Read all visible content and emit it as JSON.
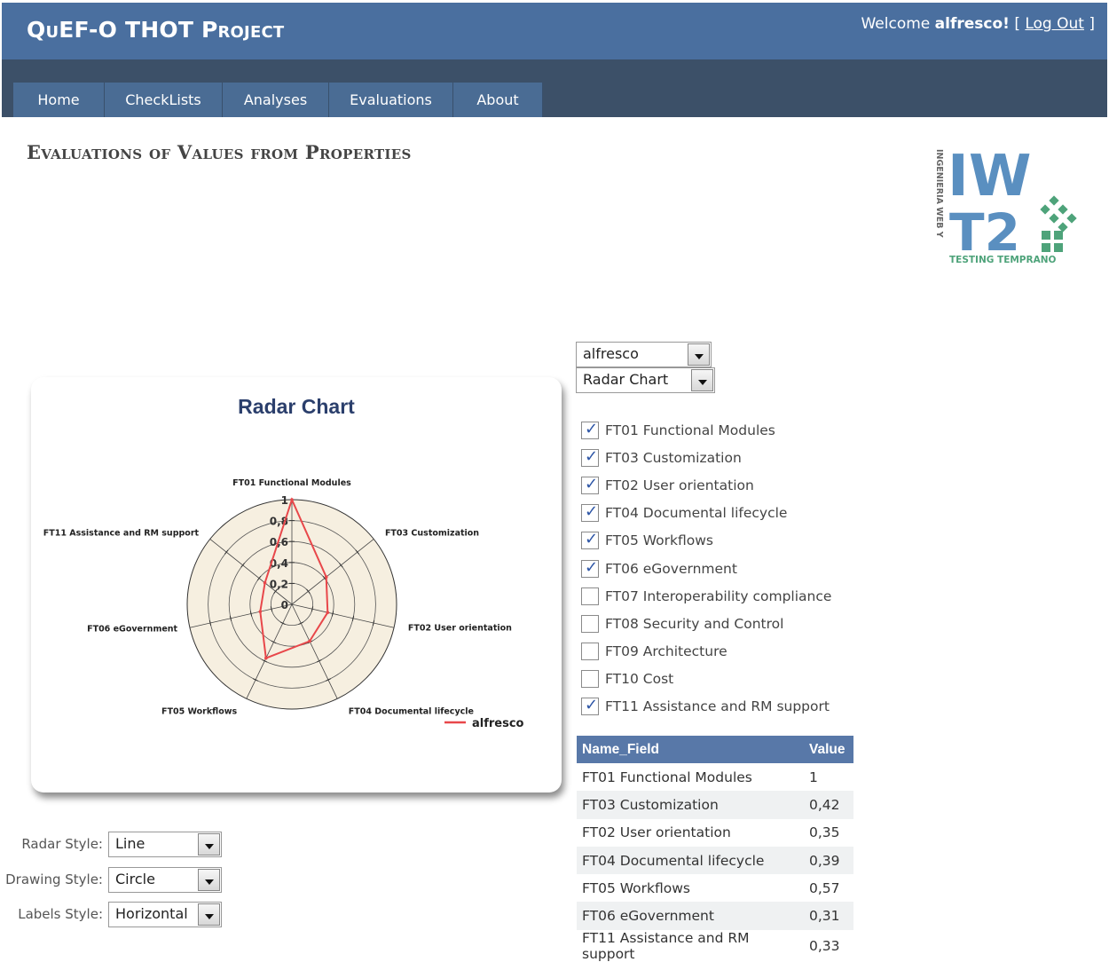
{
  "header": {
    "app_title": "QuEF-O THOT Project",
    "welcome_prefix": "Welcome",
    "username": "alfresco!",
    "bracket_open": "[",
    "logout_label": "Log Out",
    "bracket_close": "]"
  },
  "menu": {
    "items": [
      {
        "label": "Home"
      },
      {
        "label": "CheckLists"
      },
      {
        "label": "Analyses"
      },
      {
        "label": "Evaluations"
      },
      {
        "label": "About"
      }
    ]
  },
  "page": {
    "title": "Evaluations of Values from Properties"
  },
  "logo": {
    "letters_top": "IW",
    "letters_bottom": "T2",
    "side_text": "INGENIERIA WEB Y",
    "bottom_text": "TESTING TEMPRANO",
    "colors": {
      "blue": "#5a8fc0",
      "green": "#4ea37a"
    }
  },
  "selects": {
    "product": "alfresco",
    "chart_type": "Radar Chart"
  },
  "checklist": [
    {
      "label": "FT01 Functional Modules",
      "checked": true
    },
    {
      "label": "FT03 Customization",
      "checked": true
    },
    {
      "label": "FT02 User orientation",
      "checked": true
    },
    {
      "label": "FT04 Documental lifecycle",
      "checked": true
    },
    {
      "label": "FT05 Workflows",
      "checked": true
    },
    {
      "label": "FT06 eGovernment",
      "checked": true
    },
    {
      "label": "FT07 Interoperability compliance",
      "checked": false
    },
    {
      "label": "FT08 Security and Control",
      "checked": false
    },
    {
      "label": "FT09 Architecture",
      "checked": false
    },
    {
      "label": "FT10 Cost",
      "checked": false
    },
    {
      "label": "FT11 Assistance and RM support",
      "checked": true
    }
  ],
  "table": {
    "headers": {
      "name": "Name_Field",
      "value": "Value"
    },
    "rows": [
      {
        "name": "FT01 Functional Modules",
        "value": "1"
      },
      {
        "name": "FT03 Customization",
        "value": "0,42"
      },
      {
        "name": "FT02 User orientation",
        "value": "0,35"
      },
      {
        "name": "FT04 Documental lifecycle",
        "value": "0,39"
      },
      {
        "name": "FT05 Workflows",
        "value": "0,57"
      },
      {
        "name": "FT06 eGovernment",
        "value": "0,31"
      },
      {
        "name": "FT11 Assistance and RM support",
        "value": "0,33"
      }
    ]
  },
  "style_controls": {
    "radar_style_label": "Radar Style:",
    "radar_style_value": "Line",
    "area_style_label": "Area Drawing Style:",
    "area_style_value": "Circle",
    "labels_style_label": "Labels Style:",
    "labels_style_value": "Horizontal"
  },
  "chart_data": {
    "type": "radar",
    "title": "Radar Chart",
    "categories": [
      "FT01 Functional Modules",
      "FT03 Customization",
      "FT02 User orientation",
      "FT04 Documental lifecycle",
      "FT05 Workflows",
      "FT06 eGovernment",
      "FT11 Assistance and RM support"
    ],
    "series": [
      {
        "name": "alfresco",
        "values": [
          1,
          0.42,
          0.35,
          0.39,
          0.57,
          0.31,
          0.33
        ],
        "color": "#e8474a"
      }
    ],
    "radial_ticks": [
      "0",
      "0,2",
      "0,4",
      "0,6",
      "0,8",
      "1"
    ],
    "rlim": [
      0,
      1
    ],
    "area_style": "circle",
    "background_color": "#f6efe0",
    "legend_position": "bottom-right"
  }
}
